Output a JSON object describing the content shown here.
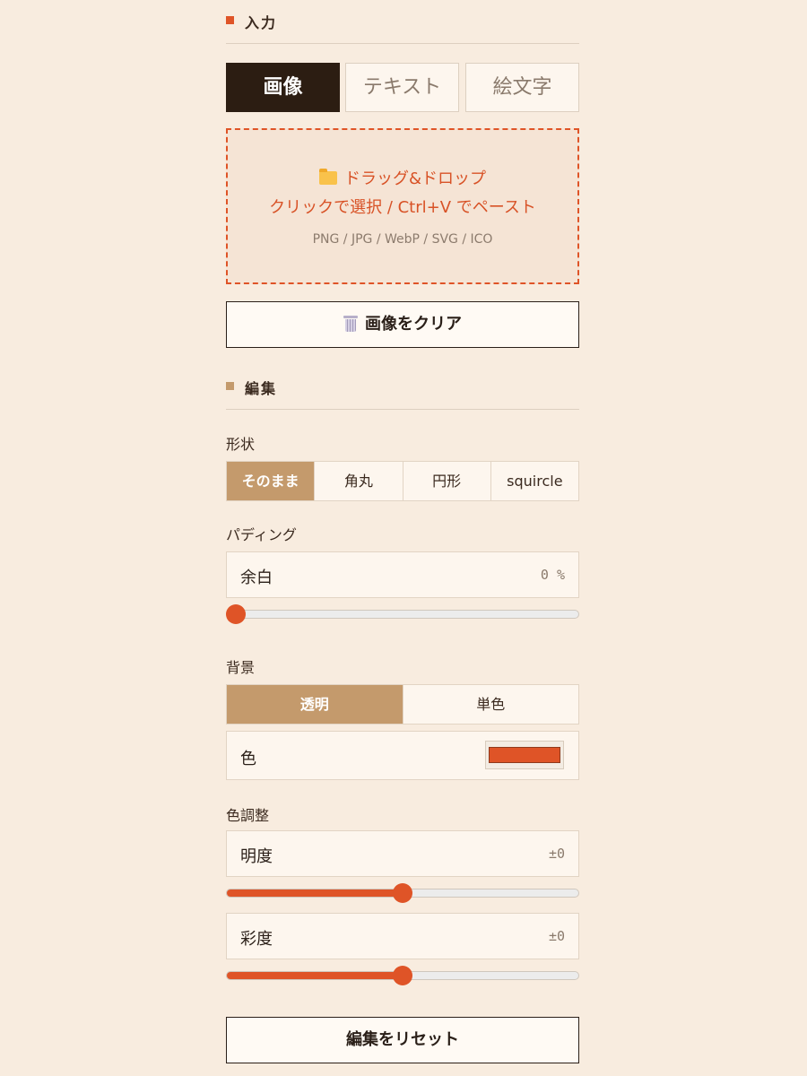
{
  "colors": {
    "accent": "#df5427",
    "secondary_accent": "#c49a6c",
    "active_tab": "#2c1d12",
    "background": "#f8ecdf"
  },
  "input_section": {
    "title": "入力",
    "tabs": [
      {
        "label": "画像",
        "active": true
      },
      {
        "label": "テキスト",
        "active": false
      },
      {
        "label": "絵文字",
        "active": false
      }
    ],
    "dropzone": {
      "icon": "folder-icon",
      "line1": "ドラッグ&ドロップ",
      "line2": "クリックで選択 / Ctrl+V でペースト",
      "formats": "PNG / JPG / WebP / SVG / ICO"
    },
    "clear_button": {
      "icon": "trash-icon",
      "label": "画像をクリア"
    }
  },
  "edit_section": {
    "title": "編集",
    "shape": {
      "label": "形状",
      "options": [
        "そのまま",
        "角丸",
        "円形",
        "squircle"
      ],
      "selected": "そのまま"
    },
    "padding": {
      "label": "パディング",
      "field_label": "余白",
      "value_text": "0 %",
      "value": 0,
      "min": 0,
      "max": 100
    },
    "background": {
      "label": "背景",
      "options": [
        "透明",
        "単色"
      ],
      "selected": "透明",
      "color_label": "色",
      "color_value": "#df5427"
    },
    "color_adjust": {
      "label": "色調整",
      "brightness": {
        "label": "明度",
        "value_text": "±0",
        "value": 0,
        "min": -100,
        "max": 100
      },
      "saturation": {
        "label": "彩度",
        "value_text": "±0",
        "value": 0,
        "min": -100,
        "max": 100
      }
    },
    "reset_button": {
      "label": "編集をリセット"
    }
  }
}
